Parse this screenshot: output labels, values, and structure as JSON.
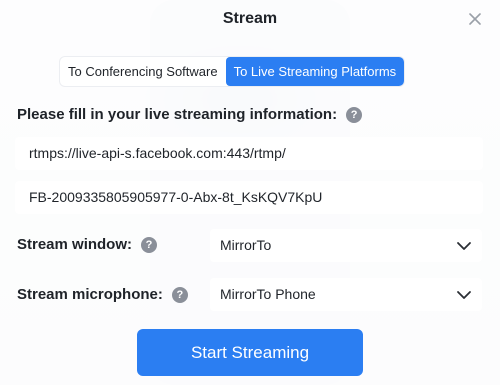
{
  "dialog": {
    "title": "Stream",
    "close_icon": "close-icon"
  },
  "tabs": [
    {
      "label": "To Conferencing Software",
      "active": false
    },
    {
      "label": "To Live Streaming Platforms",
      "active": true
    }
  ],
  "instructions": {
    "text": "Please fill in your live streaming information:",
    "help_icon": "help-icon"
  },
  "fields": {
    "server_url": "rtmps://live-api-s.facebook.com:443/rtmp/",
    "stream_key": "FB-2009335805905977-0-Abx-8t_KsKQV7KpU"
  },
  "stream_window": {
    "label": "Stream window:",
    "value": "MirrorTo"
  },
  "stream_microphone": {
    "label": "Stream microphone:",
    "value": "MirrorTo Phone"
  },
  "help_glyph": "?",
  "start_button": {
    "label": "Start Streaming"
  },
  "colors": {
    "accent": "#2b7ef2",
    "text": "#1f2329",
    "help_badge": "#8a8f99"
  }
}
